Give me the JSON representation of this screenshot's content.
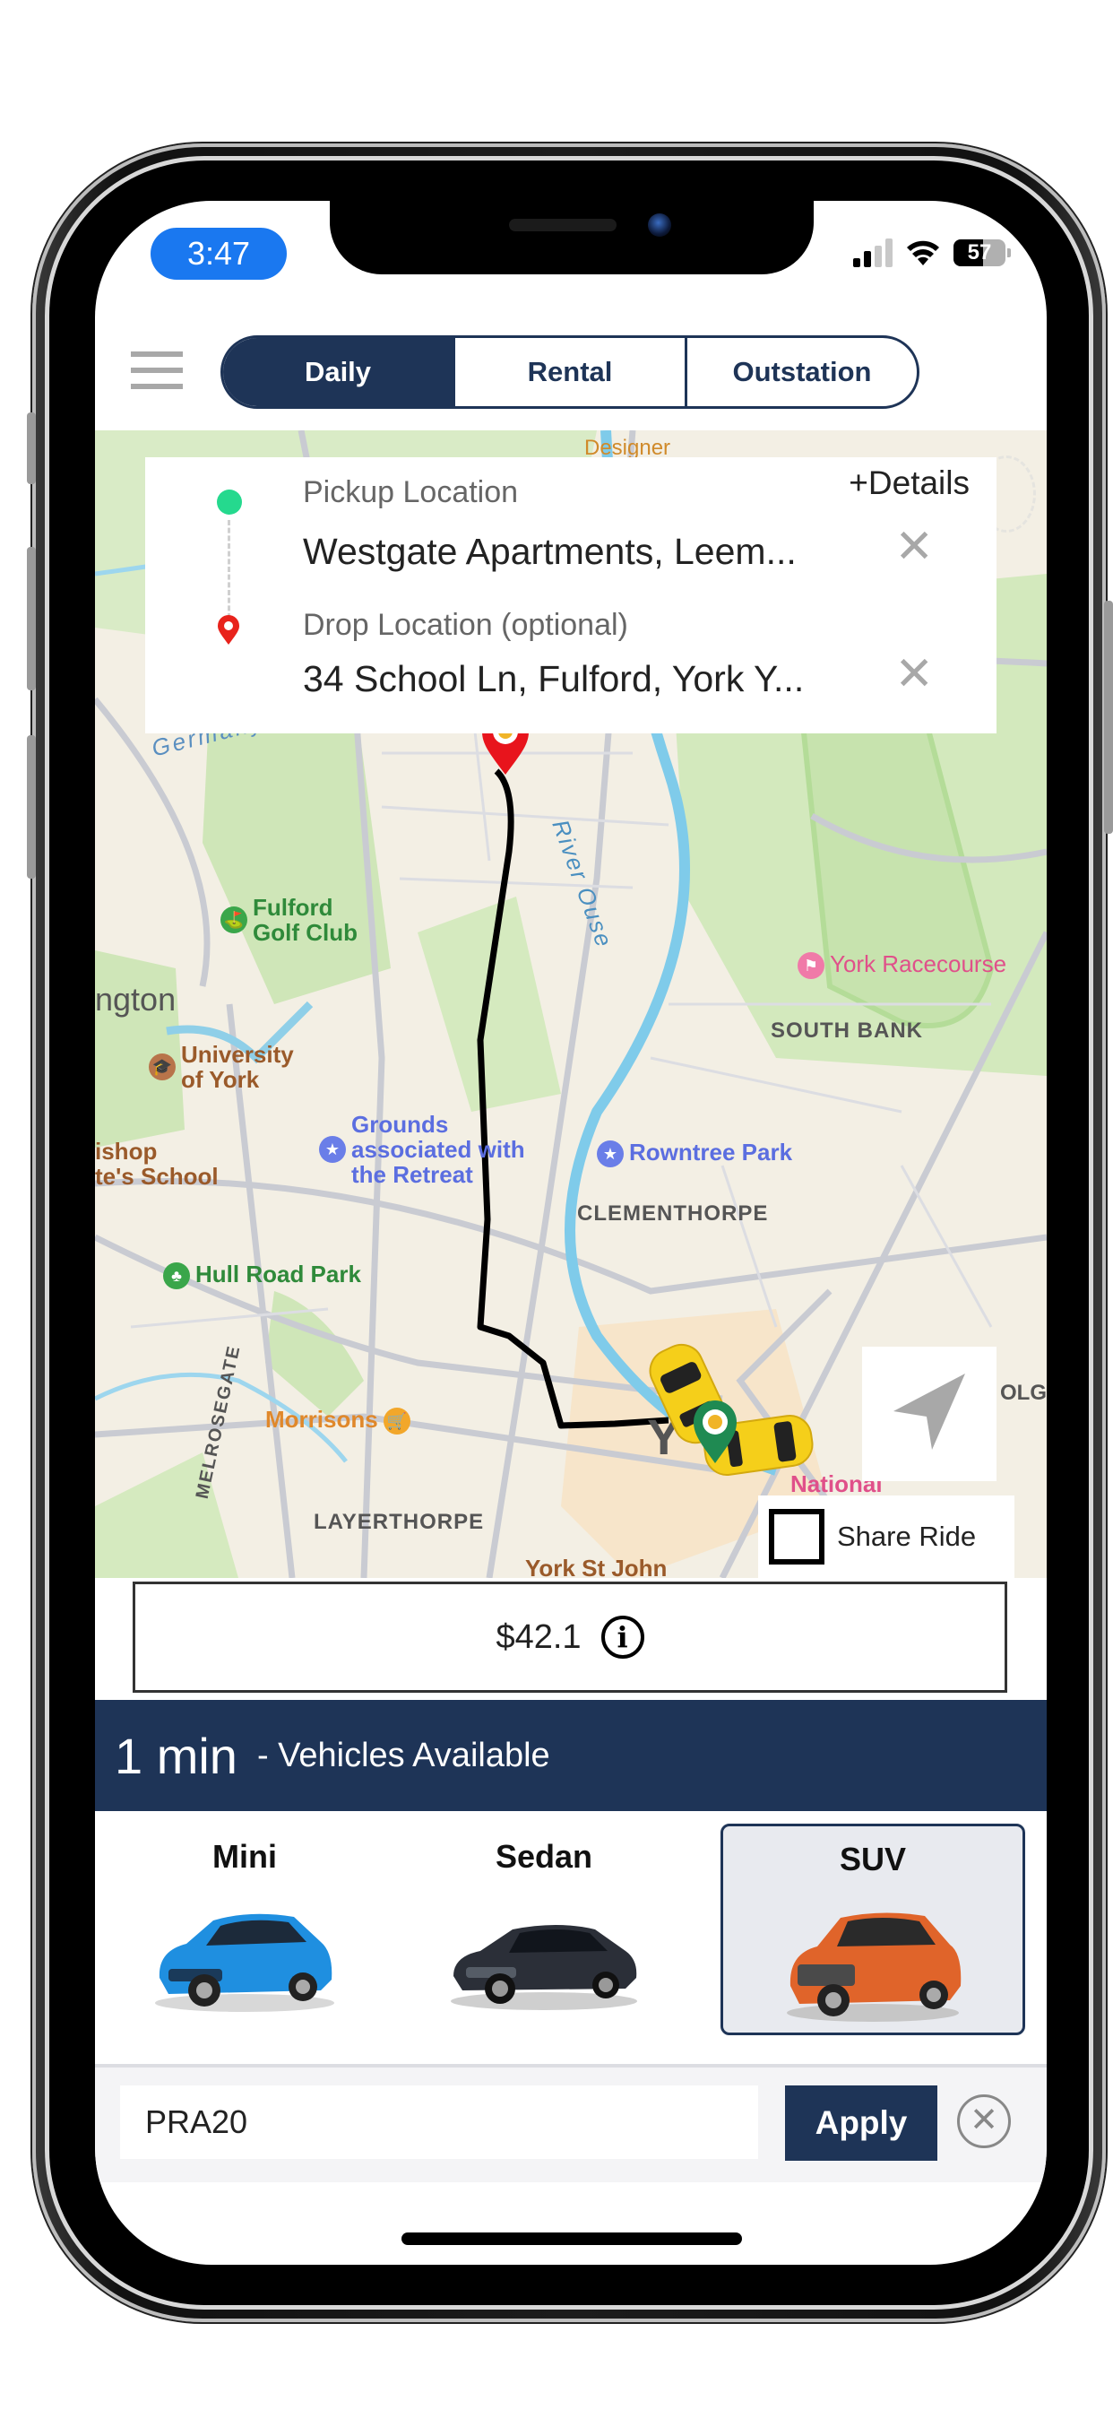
{
  "status_bar": {
    "time": "3:47",
    "battery": "57",
    "battery_level_pct": 57,
    "signal_bars_active": 2,
    "signal_bars_total": 4,
    "icons": [
      "signal-icon",
      "wifi-icon",
      "battery-icon"
    ]
  },
  "header": {
    "menu_icon": "hamburger-menu-icon",
    "tabs": [
      {
        "label": "Daily",
        "active": true
      },
      {
        "label": "Rental",
        "active": false
      },
      {
        "label": "Outstation",
        "active": false
      }
    ]
  },
  "location_card": {
    "details_link": "+Details",
    "pickup": {
      "label": "Pickup Location",
      "value": "Westgate Apartments, Leem...",
      "icon": "green-dot-icon",
      "clear_icon": "close-icon"
    },
    "drop": {
      "label": "Drop Location (optional)",
      "value": "34 School Ln, Fulford, York Y...",
      "icon": "red-pin-icon",
      "clear_icon": "close-icon"
    }
  },
  "map": {
    "labels": {
      "designer": "Designer",
      "germany_beck": "Germany Beck",
      "river_ouse": "River Ouse",
      "fulford_golf": "Fulford\nGolf Club",
      "fulford_golf_1": "Fulford",
      "fulford_golf_2": "Golf Club",
      "ington": "ngton",
      "university_1": "University",
      "university_2": "of York",
      "grounds_1": "Grounds",
      "grounds_2": "associated with",
      "grounds_3": "the Retreat",
      "bishop_1": "ishop",
      "bishop_2": "te's School",
      "york_racecourse": "York Racecourse",
      "south_bank": "SOUTH BANK",
      "rowntree_park": "Rowntree Park",
      "clementhorpe": "CLEMENTHORPE",
      "hull_road_park": "Hull Road Park",
      "melrosegate": "MELROSEGATE",
      "morrisons": "Morrisons",
      "layerthorpe": "LAYERTHORPE",
      "york_st_john": "York St John",
      "york": "Y",
      "national": "National",
      "olga": "OLGA"
    },
    "recenter_icon": "location-arrow-icon",
    "share_ride": {
      "label": "Share Ride",
      "checked": false
    }
  },
  "fare": {
    "amount": "$42.1",
    "info_icon": "info-icon"
  },
  "eta": {
    "time": "1 min",
    "text": "- Vehicles Available"
  },
  "vehicles": [
    {
      "name": "Mini",
      "color": "#1f8fe0",
      "selected": false
    },
    {
      "name": "Sedan",
      "color": "#2b2f38",
      "selected": false
    },
    {
      "name": "SUV",
      "color": "#e0642a",
      "selected": true
    }
  ],
  "promo": {
    "value": "PRA20",
    "apply_label": "Apply",
    "clear_icon": "circle-close-icon"
  },
  "colors": {
    "primary": "#1e3457",
    "pickup_green": "#25d98e",
    "drop_red": "#e8231c",
    "time_pill": "#1a78f0"
  }
}
